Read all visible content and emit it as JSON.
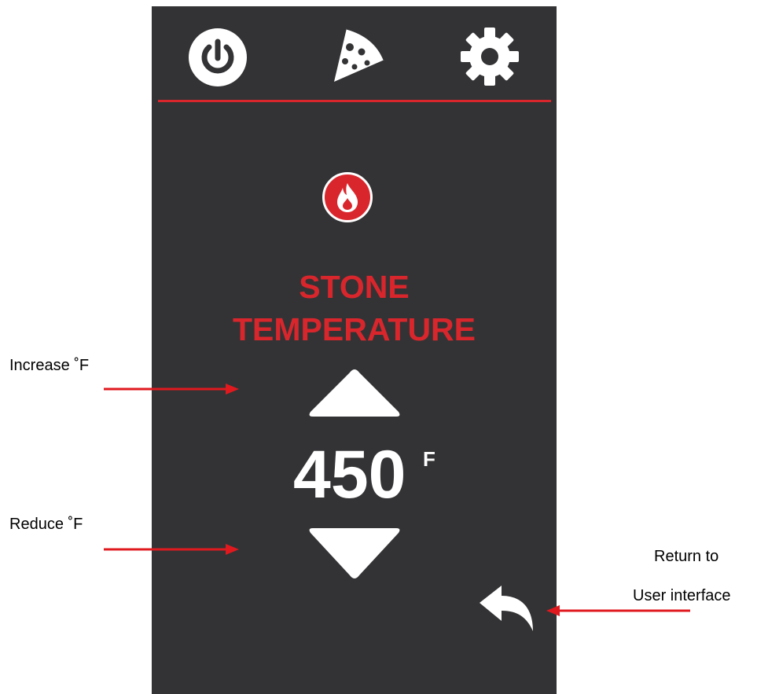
{
  "screen": {
    "title_line1": "STONE",
    "title_line2": "TEMPERATURE",
    "temperature_value": "450",
    "temperature_unit": "F"
  },
  "topbar": {
    "icons": [
      "power-icon",
      "pizza-icon",
      "gear-icon"
    ]
  },
  "annotations": {
    "increase": "Increase ˚F",
    "reduce": "Reduce ˚F",
    "return_line1": "Return to",
    "return_line2": "User interface"
  },
  "colors": {
    "accent": "#d9262c",
    "panel_bg": "#333335",
    "foreground": "#ffffff"
  }
}
